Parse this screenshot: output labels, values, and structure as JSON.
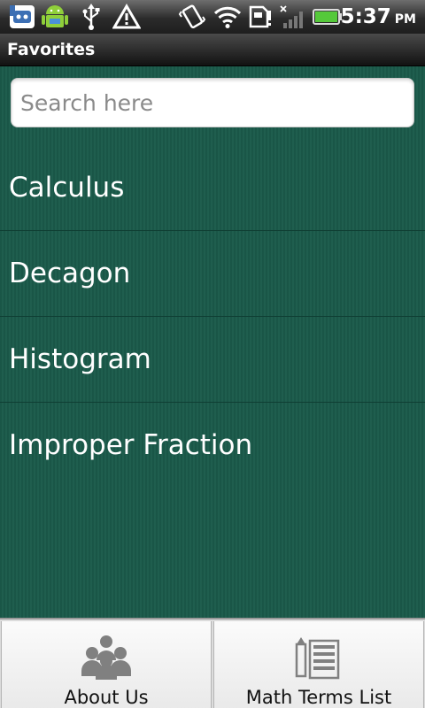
{
  "status_bar": {
    "time": "5:37",
    "ampm": "PM",
    "icons": [
      "bbm-icon",
      "android-icon",
      "usb-icon",
      "warning-icon",
      "vibrate-icon",
      "wifi-icon",
      "sd-card-icon",
      "signal-icon",
      "battery-icon"
    ]
  },
  "title_bar": {
    "title": "Favorites"
  },
  "search": {
    "placeholder": "Search here"
  },
  "favorites": [
    "Calculus",
    "Decagon",
    "Histogram",
    "Improper Fraction"
  ],
  "tabs": [
    {
      "label": "About Us",
      "icon": "people-icon"
    },
    {
      "label": "Math Terms List",
      "icon": "list-icon"
    }
  ],
  "colors": {
    "background": "#1b5b4b",
    "divider": "#0f3e33",
    "battery": "#55c93a"
  }
}
